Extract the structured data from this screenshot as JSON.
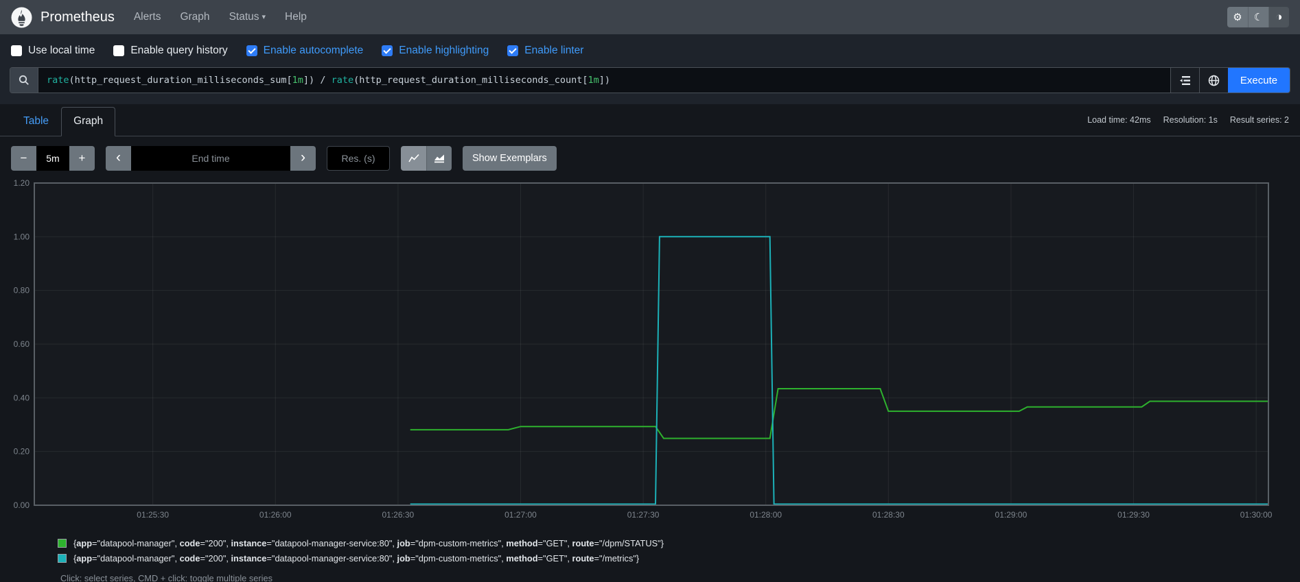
{
  "navbar": {
    "brand": "Prometheus",
    "items": [
      {
        "label": "Alerts",
        "has_caret": false
      },
      {
        "label": "Graph",
        "has_caret": false
      },
      {
        "label": "Status",
        "has_caret": true
      },
      {
        "label": "Help",
        "has_caret": false
      }
    ],
    "caret_glyph": "▾",
    "theme_icons": {
      "gear": "⚙",
      "moon": "☾",
      "contrast": "◑"
    }
  },
  "options": [
    {
      "label": "Use local time",
      "checked": false
    },
    {
      "label": "Enable query history",
      "checked": false
    },
    {
      "label": "Enable autocomplete",
      "checked": true
    },
    {
      "label": "Enable highlighting",
      "checked": true
    },
    {
      "label": "Enable linter",
      "checked": true
    }
  ],
  "query": {
    "expression": "rate(http_request_duration_milliseconds_sum[1m]) / rate(http_request_duration_milliseconds_count[1m])",
    "tokens": [
      {
        "text": "rate",
        "type": "fn"
      },
      {
        "text": "(",
        "type": "paren"
      },
      {
        "text": "http_request_duration_milliseconds_sum",
        "type": "metric"
      },
      {
        "text": "[",
        "type": "paren"
      },
      {
        "text": "1m",
        "type": "dur"
      },
      {
        "text": "])",
        "type": "paren"
      },
      {
        "text": " / ",
        "type": "op"
      },
      {
        "text": "rate",
        "type": "fn"
      },
      {
        "text": "(",
        "type": "paren"
      },
      {
        "text": "http_request_duration_milliseconds_count",
        "type": "metric"
      },
      {
        "text": "[",
        "type": "paren"
      },
      {
        "text": "1m",
        "type": "dur"
      },
      {
        "text": "])",
        "type": "paren"
      }
    ],
    "execute_label": "Execute"
  },
  "stats": {
    "load_time": "Load time: 42ms",
    "resolution": "Resolution: 1s",
    "result_series": "Result series: 2"
  },
  "tabs": [
    {
      "label": "Table",
      "active": false
    },
    {
      "label": "Graph",
      "active": true
    }
  ],
  "controls": {
    "range_minus": "−",
    "range_value": "5m",
    "range_plus": "+",
    "prev_glyph": "‹",
    "end_time_placeholder": "End time",
    "next_glyph": "›",
    "res_placeholder": "Res. (s)",
    "show_exemplars": "Show Exemplars"
  },
  "chart_data": {
    "type": "line",
    "title": "",
    "xlabel": "",
    "ylabel": "",
    "grid": true,
    "legend_position": "bottom",
    "ylim": [
      0,
      1.2
    ],
    "yticks": [
      "1.20",
      "1.00",
      "0.80",
      "0.60",
      "0.40",
      "0.20",
      "0.00"
    ],
    "x_domain_seconds_from_01_25_00": [
      1,
      303
    ],
    "xticks": [
      {
        "t": 30,
        "label": "01:25:30"
      },
      {
        "t": 60,
        "label": "01:26:00"
      },
      {
        "t": 90,
        "label": "01:26:30"
      },
      {
        "t": 120,
        "label": "01:27:00"
      },
      {
        "t": 150,
        "label": "01:27:30"
      },
      {
        "t": 180,
        "label": "01:28:00"
      },
      {
        "t": 210,
        "label": "01:28:30"
      },
      {
        "t": 240,
        "label": "01:29:00"
      },
      {
        "t": 270,
        "label": "01:29:30"
      },
      {
        "t": 300,
        "label": "01:30:00"
      }
    ],
    "series": [
      {
        "name": "{app=\"datapool-manager\", code=\"200\", instance=\"datapool-manager-service:80\", job=\"dpm-custom-metrics\", method=\"GET\", route=\"/dpm/STATUS\"}",
        "labels": {
          "app": "datapool-manager",
          "code": "200",
          "instance": "datapool-manager-service:80",
          "job": "dpm-custom-metrics",
          "method": "GET",
          "route": "/dpm/STATUS"
        },
        "color": "#2eb22e",
        "points": [
          [
            93,
            0.281
          ],
          [
            117,
            0.281
          ],
          [
            120,
            0.293
          ],
          [
            153,
            0.293
          ],
          [
            155,
            0.249
          ],
          [
            181,
            0.249
          ],
          [
            183,
            0.434
          ],
          [
            208,
            0.434
          ],
          [
            210,
            0.35
          ],
          [
            242,
            0.35
          ],
          [
            244,
            0.366
          ],
          [
            272,
            0.366
          ],
          [
            274,
            0.387
          ],
          [
            303,
            0.387
          ]
        ]
      },
      {
        "name": "{app=\"datapool-manager\", code=\"200\", instance=\"datapool-manager-service:80\", job=\"dpm-custom-metrics\", method=\"GET\", route=\"/metrics\"}",
        "labels": {
          "app": "datapool-manager",
          "code": "200",
          "instance": "datapool-manager-service:80",
          "job": "dpm-custom-metrics",
          "method": "GET",
          "route": "/metrics"
        },
        "color": "#1cb1b8",
        "points": [
          [
            93,
            0.004
          ],
          [
            153,
            0.004
          ],
          [
            154,
            1.0
          ],
          [
            181,
            1.0
          ],
          [
            182,
            0.004
          ],
          [
            303,
            0.004
          ]
        ]
      }
    ]
  },
  "legend_note": "Click: select series, CMD + click: toggle multiple series"
}
